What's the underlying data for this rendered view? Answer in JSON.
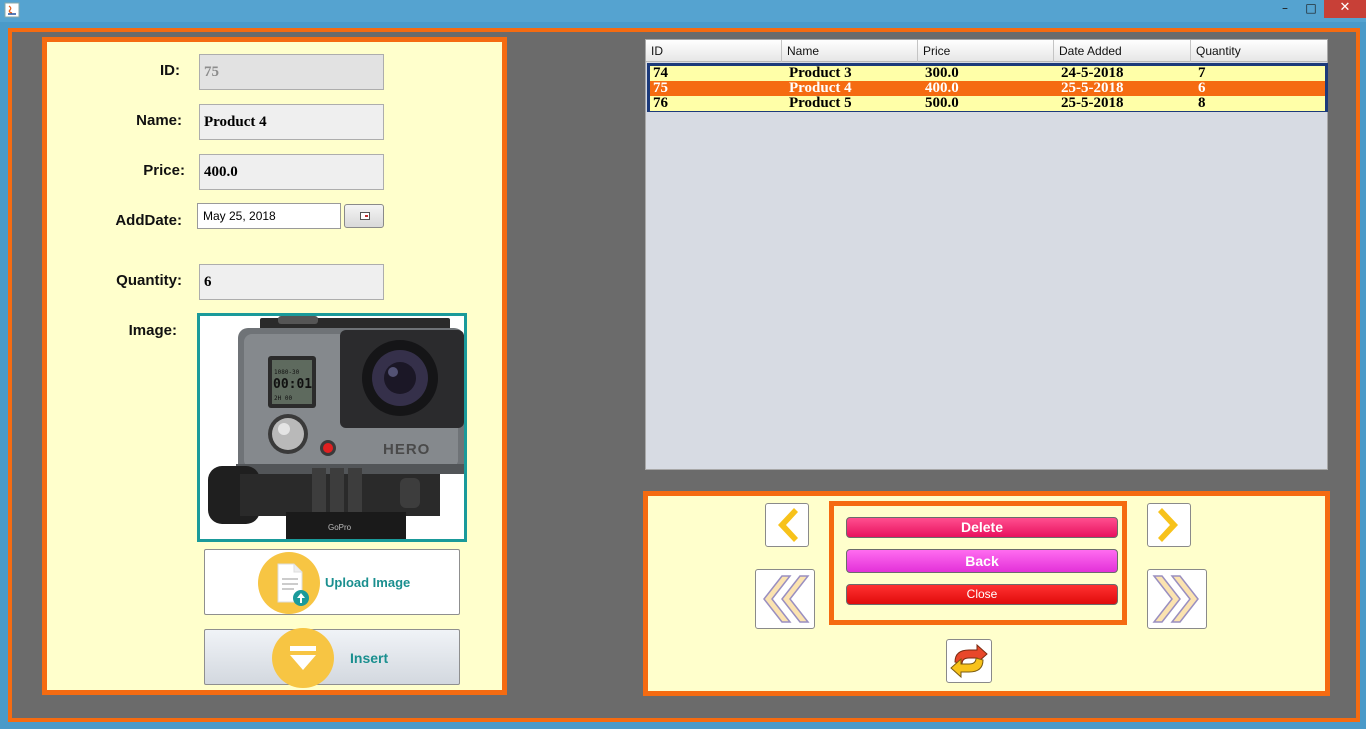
{
  "window": {
    "minimize_glyph": "–",
    "maximize_glyph": "□",
    "close_glyph": "✕",
    "icon": "java-app-icon"
  },
  "form": {
    "id_label": "ID:",
    "id_value": "75",
    "name_label": "Name:",
    "name_value": "Product 4",
    "price_label": "Price:",
    "price_value": "400.0",
    "adddate_label": "AddDate:",
    "adddate_value": "May 25, 2018",
    "quantity_label": "Quantity:",
    "quantity_value": "6",
    "image_label": "Image:",
    "image_icon": "gopro-camera-image",
    "image_text_lcd_top": "1080-30",
    "image_text_lcd_main": "00:01",
    "image_text_lcd_bottom": "2H 00",
    "image_text_brand": "HERO",
    "image_text_mount": "GoPro",
    "upload_label": "Upload Image",
    "insert_label": "Insert"
  },
  "table": {
    "columns": [
      "ID",
      "Name",
      "Price",
      "Date Added",
      "Quantity"
    ],
    "rows": [
      {
        "id": "74",
        "name": "Product 3",
        "price": "300.0",
        "date": "24-5-2018",
        "quantity": "7",
        "selected": false
      },
      {
        "id": "75",
        "name": "Product 4",
        "price": "400.0",
        "date": "25-5-2018",
        "quantity": "6",
        "selected": true
      },
      {
        "id": "76",
        "name": "Product 5",
        "price": "500.0",
        "date": "25-5-2018",
        "quantity": "8",
        "selected": false
      }
    ]
  },
  "actions": {
    "delete_label": "Delete",
    "back_label": "Back",
    "close_label": "Close"
  },
  "colors": {
    "accent_orange": "#f56b11",
    "panel_bg": "#ffffcc",
    "row_bg": "#ffffa8",
    "icon_yellow": "#f7c543",
    "teal_text": "#1a8f8f",
    "delete_pink": "#e8115e",
    "back_magenta": "#e331d8",
    "close_red": "#e00c0c"
  }
}
